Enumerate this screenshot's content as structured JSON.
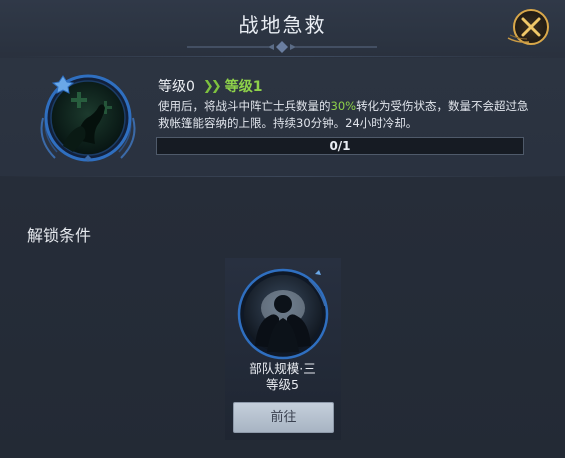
{
  "header": {
    "title": "战地急救"
  },
  "skill": {
    "level_current": "等级0",
    "level_next": "等级1",
    "description_before": "使用后，将战斗中阵亡士兵数量的",
    "description_highlight": "30%",
    "description_after": "转化为受伤状态，数量不会超过急救帐篷能容纳的上限。持续30分钟。24小时冷却。",
    "progress_text": "0/1",
    "progress_fraction": 0
  },
  "unlock": {
    "section_title": "解锁条件",
    "condition_name": "部队规模·三",
    "condition_level": "等级5",
    "go_button": "前往"
  },
  "colors": {
    "highlight_green": "#8ed14a",
    "close_gold": "#e8b94a",
    "icon_ring_blue": "#2f6fc0"
  },
  "icons": {
    "close": "close-x-icon",
    "skill": "first-aid-skill-icon",
    "condition": "troop-scale-icon",
    "arrows": "double-chevron-right-icon"
  }
}
